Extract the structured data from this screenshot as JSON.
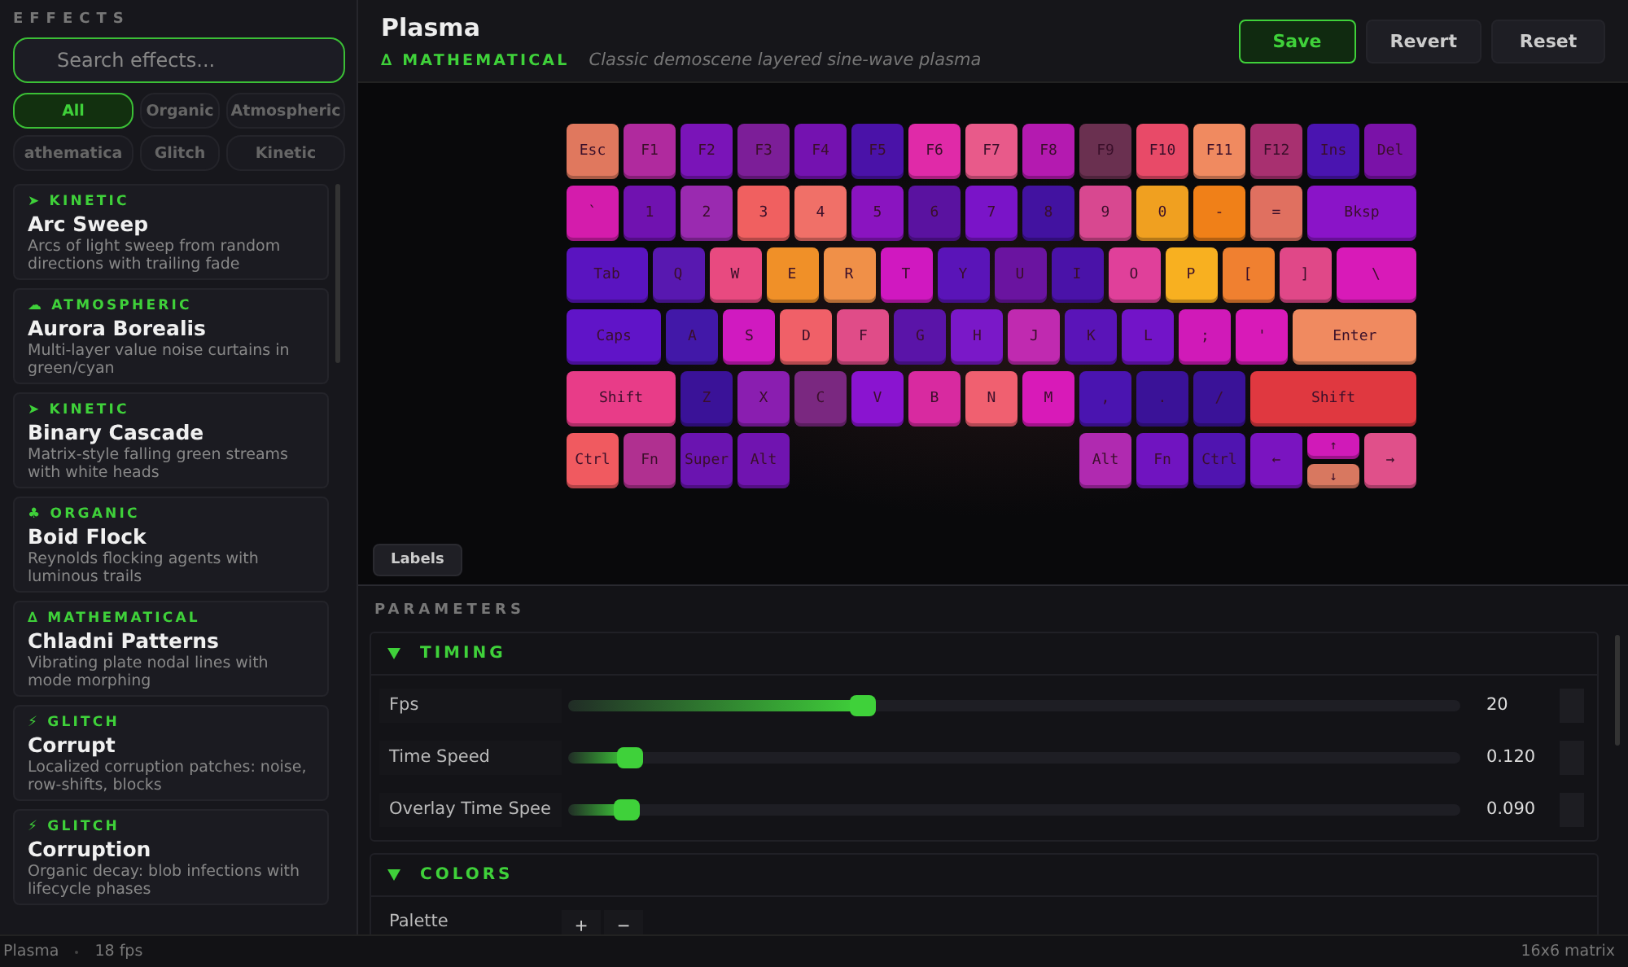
{
  "sidebar": {
    "heading": "EFFECTS",
    "search": {
      "placeholder": "Search effects..."
    },
    "filters": [
      {
        "label": "All",
        "selected": true
      },
      {
        "label": "Organic",
        "selected": false
      },
      {
        "label": "Atmospheric",
        "selected": false
      },
      {
        "label": "athematica",
        "selected": false
      },
      {
        "label": "Glitch",
        "selected": false
      },
      {
        "label": "Kinetic",
        "selected": false
      }
    ],
    "effects": [
      {
        "icon": "➤",
        "category": "KINETIC",
        "name": "Arc Sweep",
        "description": "Arcs of light sweep from random directions with trailing fade"
      },
      {
        "icon": "☁",
        "category": "ATMOSPHERIC",
        "name": "Aurora Borealis",
        "description": "Multi-layer value noise curtains in green/cyan"
      },
      {
        "icon": "➤",
        "category": "KINETIC",
        "name": "Binary Cascade",
        "description": "Matrix-style falling green streams with white heads"
      },
      {
        "icon": "♣",
        "category": "ORGANIC",
        "name": "Boid Flock",
        "description": "Reynolds flocking agents with luminous trails"
      },
      {
        "icon": "∆",
        "category": "MATHEMATICAL",
        "name": "Chladni Patterns",
        "description": "Vibrating plate nodal lines with mode morphing"
      },
      {
        "icon": "⚡",
        "category": "GLITCH",
        "name": "Corrupt",
        "description": "Localized corruption patches: noise, row-shifts, blocks"
      },
      {
        "icon": "⚡",
        "category": "GLITCH",
        "name": "Corruption",
        "description": "Organic decay: blob infections with lifecycle phases"
      }
    ]
  },
  "header": {
    "title": "Plasma",
    "category": "∆ MATHEMATICAL",
    "description": "Classic demoscene layered sine-wave plasma",
    "buttons": [
      {
        "label": "Save",
        "kind": "primary"
      },
      {
        "label": "Revert",
        "kind": "plain"
      },
      {
        "label": "Reset",
        "kind": "plain"
      }
    ]
  },
  "keyboard": {
    "rows": [
      {
        "keys": [
          {
            "label": "Esc",
            "kind": "unit",
            "color": "#e0785e"
          },
          {
            "label": "F1",
            "kind": "unit",
            "color": "#b02a9e"
          },
          {
            "label": "F2",
            "kind": "unit",
            "color": "#7a14b8"
          },
          {
            "label": "F3",
            "kind": "unit",
            "color": "#7c1e98"
          },
          {
            "label": "F4",
            "kind": "unit",
            "color": "#7412b0"
          },
          {
            "label": "F5",
            "kind": "unit",
            "color": "#4a12a8"
          },
          {
            "label": "F6",
            "kind": "unit",
            "color": "#e02aa8"
          },
          {
            "label": "F7",
            "kind": "unit",
            "color": "#e85a8a"
          },
          {
            "label": "F8",
            "kind": "unit",
            "color": "#b41ab0"
          },
          {
            "label": "F9",
            "kind": "unit",
            "color": "#6a3050"
          },
          {
            "label": "F10",
            "kind": "unit",
            "color": "#e84a68"
          },
          {
            "label": "F11",
            "kind": "unit",
            "color": "#f08a60"
          },
          {
            "label": "F12",
            "kind": "unit",
            "color": "#a83070"
          },
          {
            "label": "Ins",
            "kind": "unit",
            "color": "#4a14b0"
          },
          {
            "label": "Del",
            "kind": "unit",
            "color": "#7a12a8"
          }
        ]
      },
      {
        "keys": [
          {
            "label": "`",
            "kind": "unit",
            "color": "#d41cac"
          },
          {
            "label": "1",
            "kind": "unit",
            "color": "#7012b0"
          },
          {
            "label": "2",
            "kind": "unit",
            "color": "#9a2ab0"
          },
          {
            "label": "3",
            "kind": "unit",
            "color": "#f06060"
          },
          {
            "label": "4",
            "kind": "unit",
            "color": "#f07068"
          },
          {
            "label": "5",
            "kind": "unit",
            "color": "#8a14c0"
          },
          {
            "label": "6",
            "kind": "unit",
            "color": "#5a12a0"
          },
          {
            "label": "7",
            "kind": "unit",
            "color": "#7a14c8"
          },
          {
            "label": "8",
            "kind": "unit",
            "color": "#4212a0"
          },
          {
            "label": "9",
            "kind": "unit",
            "color": "#d84890"
          },
          {
            "label": "0",
            "kind": "unit",
            "color": "#f0a020"
          },
          {
            "label": "-",
            "kind": "unit",
            "color": "#f08018"
          },
          {
            "label": "=",
            "kind": "unit",
            "color": "#e07060"
          },
          {
            "label": "Bksp",
            "kind": "double",
            "color": "#8a14c8"
          }
        ]
      },
      {
        "keys": [
          {
            "label": "Tab",
            "kind": "wide",
            "color": "#5a14c0"
          },
          {
            "label": "Q",
            "kind": "unit",
            "color": "#5818b0"
          },
          {
            "label": "W",
            "kind": "unit",
            "color": "#e84a80"
          },
          {
            "label": "E",
            "kind": "unit",
            "color": "#f09028"
          },
          {
            "label": "R",
            "kind": "unit",
            "color": "#f09048"
          },
          {
            "label": "T",
            "kind": "unit",
            "color": "#d018c0"
          },
          {
            "label": "Y",
            "kind": "unit",
            "color": "#5a14b8"
          },
          {
            "label": "U",
            "kind": "unit",
            "color": "#6a14a0"
          },
          {
            "label": "I",
            "kind": "unit",
            "color": "#4a12a8"
          },
          {
            "label": "O",
            "kind": "unit",
            "color": "#e0409a"
          },
          {
            "label": "P",
            "kind": "unit",
            "color": "#f8b020"
          },
          {
            "label": "[",
            "kind": "unit",
            "color": "#f08030"
          },
          {
            "label": "]",
            "kind": "unit",
            "color": "#e04888"
          },
          {
            "label": "\\",
            "kind": "wide",
            "color": "#d81ab8"
          }
        ]
      },
      {
        "keys": [
          {
            "label": "Caps",
            "kind": "caps",
            "color": "#6014c8"
          },
          {
            "label": "A",
            "kind": "unit",
            "color": "#4218a8"
          },
          {
            "label": "S",
            "kind": "unit",
            "color": "#d01ac0"
          },
          {
            "label": "D",
            "kind": "unit",
            "color": "#f06068"
          },
          {
            "label": "F",
            "kind": "unit",
            "color": "#e04c88"
          },
          {
            "label": "G",
            "kind": "unit",
            "color": "#5a14a8"
          },
          {
            "label": "H",
            "kind": "unit",
            "color": "#7a18c8"
          },
          {
            "label": "J",
            "kind": "unit",
            "color": "#c02ab0"
          },
          {
            "label": "K",
            "kind": "unit",
            "color": "#5a14b8"
          },
          {
            "label": "L",
            "kind": "unit",
            "color": "#7214c8"
          },
          {
            "label": ";",
            "kind": "unit",
            "color": "#d01ab8"
          },
          {
            "label": "'",
            "kind": "unit",
            "color": "#d81ab8"
          },
          {
            "label": "Enter",
            "kind": "enter",
            "color": "#f08a60"
          }
        ]
      },
      {
        "keys": [
          {
            "label": "Shift",
            "kind": "double",
            "color": "#e83c88"
          },
          {
            "label": "Z",
            "kind": "unit",
            "color": "#3a1298"
          },
          {
            "label": "X",
            "kind": "unit",
            "color": "#8a1eb0"
          },
          {
            "label": "C",
            "kind": "unit",
            "color": "#7a2880"
          },
          {
            "label": "V",
            "kind": "unit",
            "color": "#8a14d0"
          },
          {
            "label": "B",
            "kind": "unit",
            "color": "#d82aa0"
          },
          {
            "label": "N",
            "kind": "unit",
            "color": "#f06070"
          },
          {
            "label": "M",
            "kind": "unit",
            "color": "#d81ab8"
          },
          {
            "label": ",",
            "kind": "unit",
            "color": "#4a14b0"
          },
          {
            "label": ".",
            "kind": "unit",
            "color": "#3a1298"
          },
          {
            "label": "/",
            "kind": "unit",
            "color": "#3a1298"
          },
          {
            "label": "Shift",
            "kind": "triple",
            "color": "#e03840"
          }
        ]
      },
      {
        "keys": [
          {
            "label": "Ctrl",
            "kind": "unit",
            "color": "#f05a60"
          },
          {
            "label": "Fn",
            "kind": "unit",
            "color": "#b03090"
          },
          {
            "label": "Super",
            "kind": "unit",
            "color": "#6a14b0"
          },
          {
            "label": "Alt",
            "kind": "unit",
            "color": "#7014b0"
          }
        ],
        "right_keys": [
          {
            "label": "Alt",
            "kind": "unit",
            "color": "#b02ab0"
          },
          {
            "label": "Fn",
            "kind": "unit",
            "color": "#7014c0"
          },
          {
            "label": "Ctrl",
            "kind": "unit",
            "color": "#5014b0"
          },
          {
            "label": "←",
            "kind": "unit",
            "color": "#7a14c0"
          },
          {
            "label": "↑",
            "kind": "half",
            "color": "#d01ab8"
          },
          {
            "label": "↓",
            "kind": "half",
            "color": "#d87860"
          },
          {
            "label": "→",
            "kind": "unit",
            "color": "#e0508a"
          }
        ]
      }
    ],
    "labels_button": "Labels"
  },
  "parameters": {
    "heading": "PARAMETERS",
    "sections": [
      {
        "title": "TIMING",
        "expanded": true,
        "rows": [
          {
            "kind": "slider",
            "label": "Fps",
            "level": 0.33,
            "value": "20"
          },
          {
            "kind": "slider",
            "label": "Time Speed",
            "level": 0.07,
            "value": "0.120"
          },
          {
            "kind": "slider",
            "label": "Overlay Time Spee",
            "level": 0.065,
            "value": "0.090"
          }
        ]
      },
      {
        "title": "COLORS",
        "expanded": true,
        "rows": [
          {
            "kind": "palette",
            "label": "Palette",
            "add": "+",
            "remove": "−"
          }
        ]
      }
    ]
  },
  "status_bar": {
    "effect": "Plasma",
    "fps": "18 fps",
    "matrix": "16x6 matrix"
  }
}
